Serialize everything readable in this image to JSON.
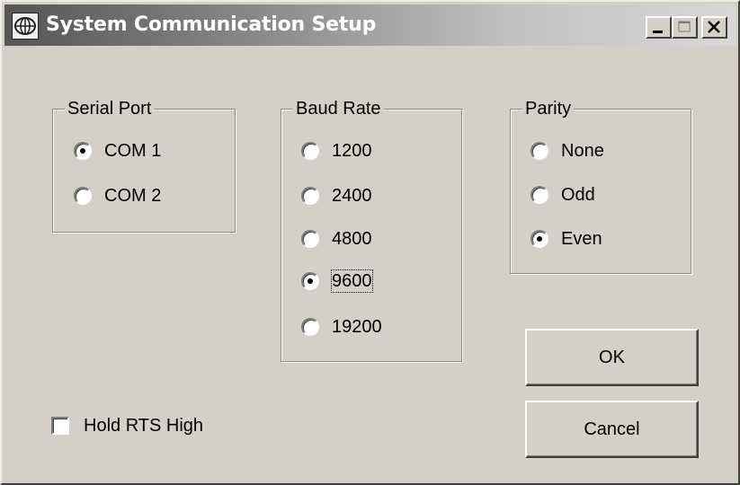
{
  "window": {
    "title": "System Communication Setup"
  },
  "serial_port": {
    "legend": "Serial Port",
    "options": [
      {
        "label": "COM 1",
        "checked": true
      },
      {
        "label": "COM 2",
        "checked": false
      }
    ]
  },
  "baud_rate": {
    "legend": "Baud Rate",
    "options": [
      {
        "label": "1200",
        "checked": false
      },
      {
        "label": "2400",
        "checked": false
      },
      {
        "label": "4800",
        "checked": false
      },
      {
        "label": "9600",
        "checked": true
      },
      {
        "label": "19200",
        "checked": false
      }
    ]
  },
  "parity": {
    "legend": "Parity",
    "options": [
      {
        "label": "None",
        "checked": false
      },
      {
        "label": "Odd",
        "checked": false
      },
      {
        "label": "Even",
        "checked": true
      }
    ]
  },
  "hold_rts": {
    "label": "Hold RTS High",
    "checked": false
  },
  "buttons": {
    "ok": "OK",
    "cancel": "Cancel"
  }
}
